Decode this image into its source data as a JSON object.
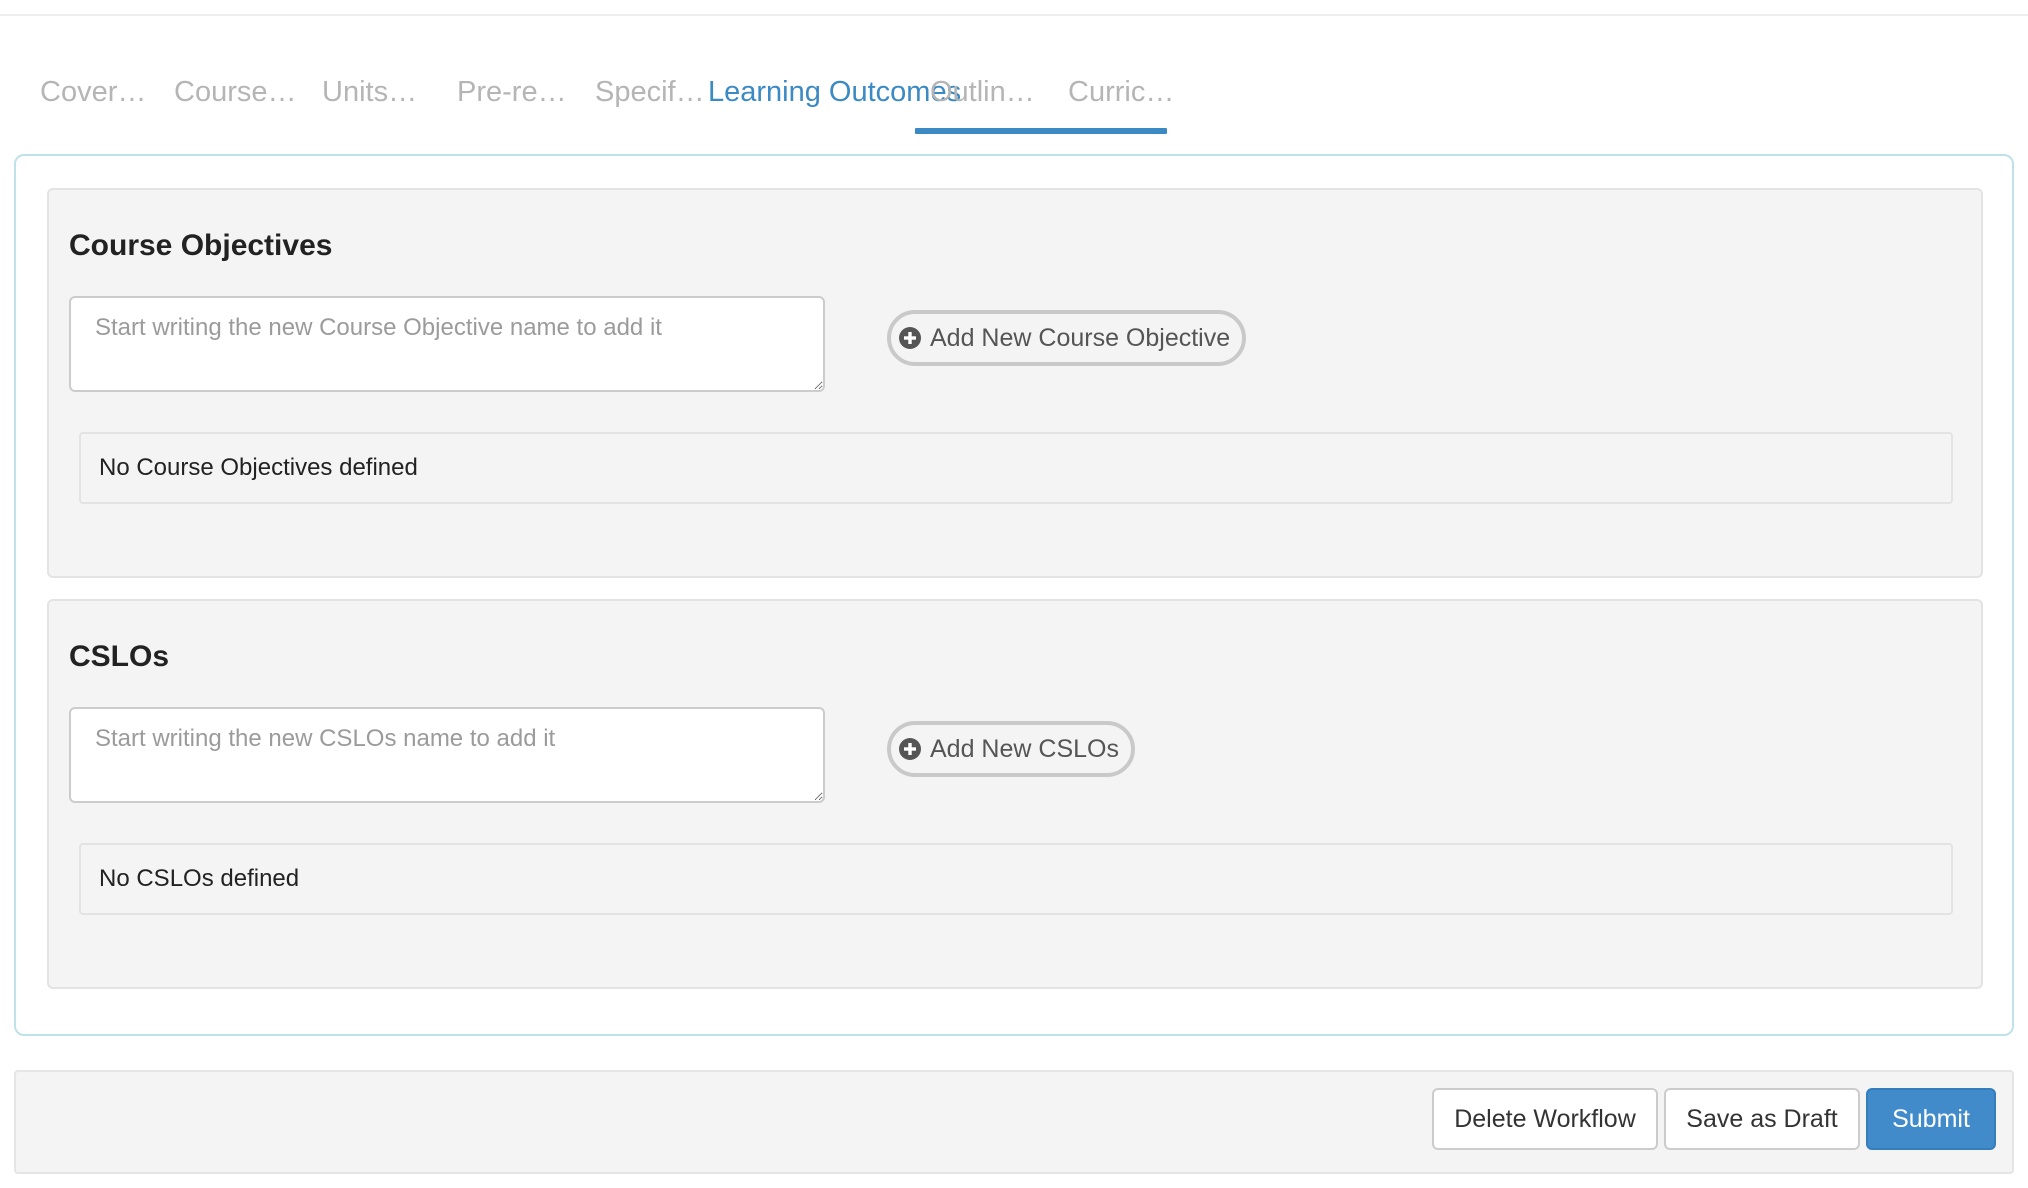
{
  "tabs": [
    {
      "label": "Cover…",
      "active": false
    },
    {
      "label": "Course…",
      "active": false
    },
    {
      "label": "Units…",
      "active": false
    },
    {
      "label": "Pre-re…",
      "active": false
    },
    {
      "label": "Specif…",
      "active": false
    },
    {
      "label": "Learning Outcomes",
      "active": true
    },
    {
      "label": "Outlin…",
      "active": false
    },
    {
      "label": "Curric…",
      "active": false
    }
  ],
  "objectives": {
    "title": "Course Objectives",
    "input": {
      "value": "",
      "placeholder": "Start writing the new Course Objective name to add it"
    },
    "add_label": "Add New Course Objective",
    "add_icon": "plus-circle-icon",
    "empty_text": "No Course Objectives defined"
  },
  "cslos": {
    "title": "CSLOs",
    "input": {
      "value": "",
      "placeholder": "Start writing the new CSLOs name to add it"
    },
    "add_label": "Add New CSLOs",
    "add_icon": "plus-circle-icon",
    "empty_text": "No CSLOs defined"
  },
  "footer": {
    "delete_label": "Delete Workflow",
    "draft_label": "Save as Draft",
    "submit_label": "Submit"
  },
  "colors": {
    "accent": "#3c8ac4",
    "primary_button": "#428bca",
    "inactive_tab": "#b5b5b5",
    "panel_border": "#bfe1ea",
    "section_bg": "#f4f4f4"
  }
}
